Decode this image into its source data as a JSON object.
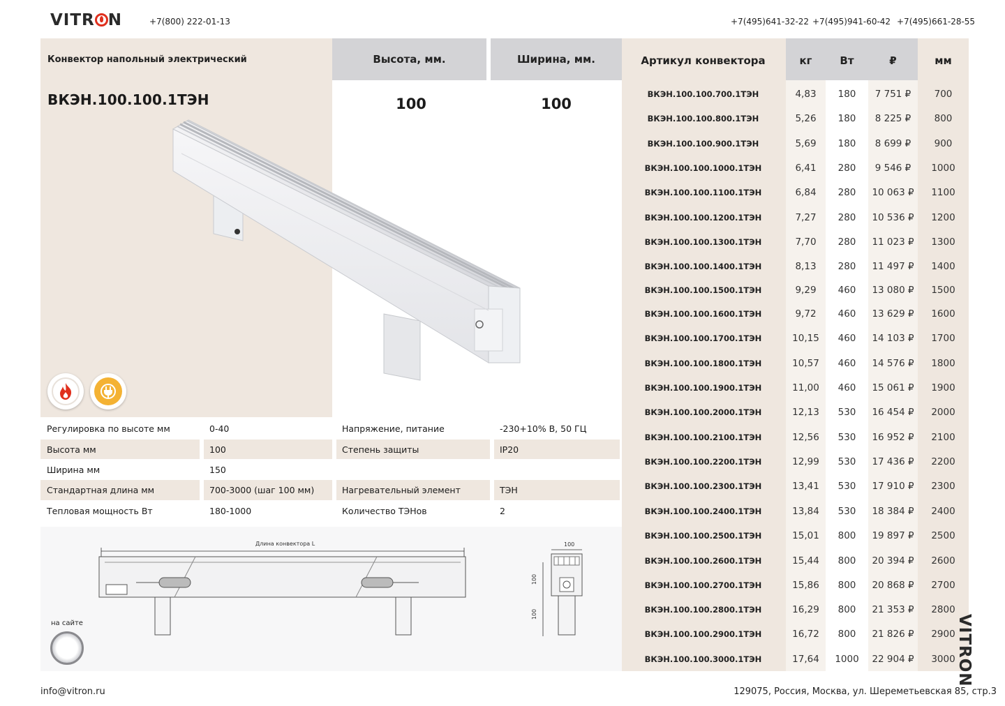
{
  "header": {
    "logo": "VITRON",
    "phone_main": "+7(800) 222-01-13",
    "phones": [
      "+7(495)641-32-22",
      "+7(495)941-60-42",
      "+7(495)661-28-55"
    ]
  },
  "product": {
    "subtitle": "Конвектор напольный электрический",
    "title": "ВКЭН.100.100.1ТЭН",
    "height_label": "Высота, мм.",
    "width_label": "Ширина, мм.",
    "height_value": "100",
    "width_value": "100",
    "badges": [
      "flame-icon",
      "plug-icon"
    ]
  },
  "specs": {
    "left": [
      {
        "label": "Регулировка по высоте мм",
        "value": "0-40"
      },
      {
        "label": "Высота мм",
        "value": "100"
      },
      {
        "label": "Ширина мм",
        "value": "150"
      },
      {
        "label": "Стандартная длина мм",
        "value": "700-3000 (шаг 100 мм)"
      },
      {
        "label": "Тепловая мощность Вт",
        "value": "180-1000"
      }
    ],
    "right": [
      {
        "label": "Напряжение, питание",
        "value": "-230+10% В, 50 ГЦ"
      },
      {
        "label": "Степень защиты",
        "value": "IP20"
      },
      {
        "label": "",
        "value": ""
      },
      {
        "label": "Нагревательный элемент",
        "value": "ТЭН"
      },
      {
        "label": "Количество ТЭНов",
        "value": "2"
      }
    ]
  },
  "drawing": {
    "length_label": "Длина конвектора L",
    "dim_top": "100",
    "dim_h1": "100",
    "dim_h2": "100"
  },
  "site": {
    "label": "на сайте"
  },
  "table": {
    "headers": {
      "sku": "Артикул конвектора",
      "kg": "кг",
      "w": "Вт",
      "rub": "₽",
      "mm": "мм"
    },
    "rows": [
      {
        "sku": "ВКЭН.100.100.700.1ТЭН",
        "kg": "4,83",
        "w": "180",
        "price": "7 751 ₽",
        "mm": "700"
      },
      {
        "sku": "ВКЭН.100.100.800.1ТЭН",
        "kg": "5,26",
        "w": "180",
        "price": "8 225 ₽",
        "mm": "800"
      },
      {
        "sku": "ВКЭН.100.100.900.1ТЭН",
        "kg": "5,69",
        "w": "180",
        "price": "8 699 ₽",
        "mm": "900"
      },
      {
        "sku": "ВКЭН.100.100.1000.1ТЭН",
        "kg": "6,41",
        "w": "280",
        "price": "9 546 ₽",
        "mm": "1000"
      },
      {
        "sku": "ВКЭН.100.100.1100.1ТЭН",
        "kg": "6,84",
        "w": "280",
        "price": "10 063 ₽",
        "mm": "1100"
      },
      {
        "sku": "ВКЭН.100.100.1200.1ТЭН",
        "kg": "7,27",
        "w": "280",
        "price": "10 536 ₽",
        "mm": "1200"
      },
      {
        "sku": "ВКЭН.100.100.1300.1ТЭН",
        "kg": "7,70",
        "w": "280",
        "price": "11 023 ₽",
        "mm": "1300"
      },
      {
        "sku": "ВКЭН.100.100.1400.1ТЭН",
        "kg": "8,13",
        "w": "280",
        "price": "11 497 ₽",
        "mm": "1400"
      },
      {
        "sku": "ВКЭН.100.100.1500.1ТЭН",
        "kg": "9,29",
        "w": "460",
        "price": "13 080 ₽",
        "mm": "1500"
      },
      {
        "sku": "ВКЭН.100.100.1600.1ТЭН",
        "kg": "9,72",
        "w": "460",
        "price": "13 629 ₽",
        "mm": "1600"
      },
      {
        "sku": "ВКЭН.100.100.1700.1ТЭН",
        "kg": "10,15",
        "w": "460",
        "price": "14 103 ₽",
        "mm": "1700"
      },
      {
        "sku": "ВКЭН.100.100.1800.1ТЭН",
        "kg": "10,57",
        "w": "460",
        "price": "14 576 ₽",
        "mm": "1800"
      },
      {
        "sku": "ВКЭН.100.100.1900.1ТЭН",
        "kg": "11,00",
        "w": "460",
        "price": "15 061 ₽",
        "mm": "1900"
      },
      {
        "sku": "ВКЭН.100.100.2000.1ТЭН",
        "kg": "12,13",
        "w": "530",
        "price": "16 454 ₽",
        "mm": "2000"
      },
      {
        "sku": "ВКЭН.100.100.2100.1ТЭН",
        "kg": "12,56",
        "w": "530",
        "price": "16 952 ₽",
        "mm": "2100"
      },
      {
        "sku": "ВКЭН.100.100.2200.1ТЭН",
        "kg": "12,99",
        "w": "530",
        "price": "17 436 ₽",
        "mm": "2200"
      },
      {
        "sku": "ВКЭН.100.100.2300.1ТЭН",
        "kg": "13,41",
        "w": "530",
        "price": "17 910 ₽",
        "mm": "2300"
      },
      {
        "sku": "ВКЭН.100.100.2400.1ТЭН",
        "kg": "13,84",
        "w": "530",
        "price": "18 384 ₽",
        "mm": "2400"
      },
      {
        "sku": "ВКЭН.100.100.2500.1ТЭН",
        "kg": "15,01",
        "w": "800",
        "price": "19 897 ₽",
        "mm": "2500"
      },
      {
        "sku": "ВКЭН.100.100.2600.1ТЭН",
        "kg": "15,44",
        "w": "800",
        "price": "20 394 ₽",
        "mm": "2600"
      },
      {
        "sku": "ВКЭН.100.100.2700.1ТЭН",
        "kg": "15,86",
        "w": "800",
        "price": "20 868 ₽",
        "mm": "2700"
      },
      {
        "sku": "ВКЭН.100.100.2800.1ТЭН",
        "kg": "16,29",
        "w": "800",
        "price": "21 353 ₽",
        "mm": "2800"
      },
      {
        "sku": "ВКЭН.100.100.2900.1ТЭН",
        "kg": "16,72",
        "w": "800",
        "price": "21 826 ₽",
        "mm": "2900"
      },
      {
        "sku": "ВКЭН.100.100.3000.1ТЭН",
        "kg": "17,64",
        "w": "1000",
        "price": "22 904 ₽",
        "mm": "3000"
      }
    ]
  },
  "side_logo": "VITRON",
  "footer": {
    "email": "info@vitron.ru",
    "address": "129075, Россия, Москва, ул. Шереметьевская 85, стр.3"
  }
}
